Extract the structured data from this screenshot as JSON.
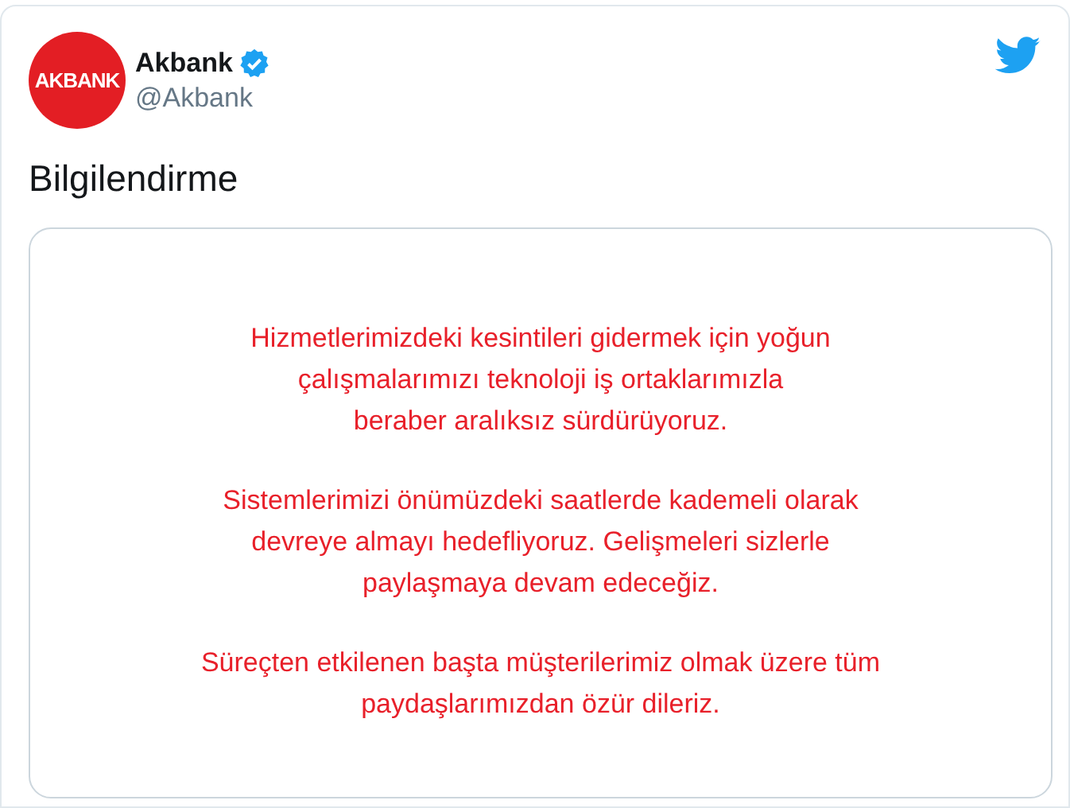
{
  "author": {
    "logo_text": "AKBANK",
    "name": "Akbank",
    "verified": true,
    "handle": "@Akbank"
  },
  "tweet_text": "Bilgilendirme",
  "card": {
    "paragraphs": [
      "Hizmetlerimizdeki kesintileri gidermek için yoğun\nçalışmalarımızı teknoloji iş ortaklarımızla\nberaber aralıksız sürdürüyoruz.",
      "Sistemlerimizi önümüzdeki saatlerde kademeli olarak\ndevreye almayı hedefliyoruz. Gelişmeleri sizlerle\npaylaşmaya devam edeceğiz.",
      "Süreçten etkilenen başta müşterilerimiz olmak üzere tüm\npaydaşlarımızdan özür dileriz."
    ]
  }
}
